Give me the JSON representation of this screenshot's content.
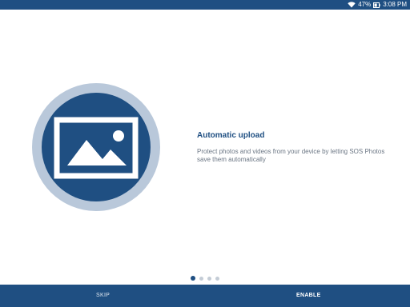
{
  "status_bar": {
    "battery": "47%",
    "time": "3:08 PM",
    "icons": [
      "wifi-icon",
      "battery-icon"
    ]
  },
  "hero": {
    "icon": "image-icon"
  },
  "content": {
    "headline": "Automatic upload",
    "description": "Protect photos and videos from your device by letting SOS Photos save them automatically"
  },
  "pager": {
    "current": 1,
    "total": 4
  },
  "actions": {
    "skip_label": "SKIP",
    "enable_label": "ENABLE"
  },
  "colors": {
    "primary": "#1f4f82",
    "ring": "#b9c8da",
    "dot_inactive": "#c4ccd6",
    "text_muted": "#6b7684"
  }
}
